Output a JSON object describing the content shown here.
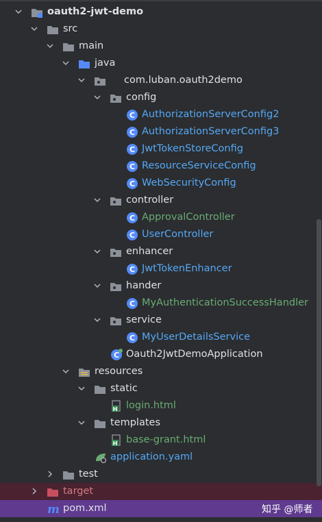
{
  "tree": {
    "root": "oauth2-jwt-demo",
    "src": "src",
    "main": "main",
    "java": "java",
    "package": "com.luban.oauth2demo",
    "config": "config",
    "config_items": [
      "AuthorizationServerConfig2",
      "AuthorizationServerConfig3",
      "JwtTokenStoreConfig",
      "ResourceServiceConfig",
      "WebSecurityConfig"
    ],
    "controller": "controller",
    "controller_items": [
      "ApprovalController",
      "UserController"
    ],
    "enhancer": "enhancer",
    "enhancer_item": "JwtTokenEnhancer",
    "hander": "hander",
    "hander_item": "MyAuthenticationSuccessHandler",
    "service": "service",
    "service_item": "MyUserDetailsService",
    "app": "Oauth2JwtDemoApplication",
    "resources": "resources",
    "static": "static",
    "login": "login.html",
    "templates": "templates",
    "base_grant": "base-grant.html",
    "application": "application.yaml",
    "test": "test",
    "target": "target",
    "pom": "pom.xml"
  },
  "watermark": "知乎 @师者",
  "colors": {
    "background": "#2b2d30",
    "text": "#dfe1e5",
    "modified_blue": "#56a8f5",
    "added_green": "#6aab73",
    "ignored_red": "#d57b82",
    "selected_purple": "#5f3a8f",
    "target_bg": "#4a2230"
  }
}
